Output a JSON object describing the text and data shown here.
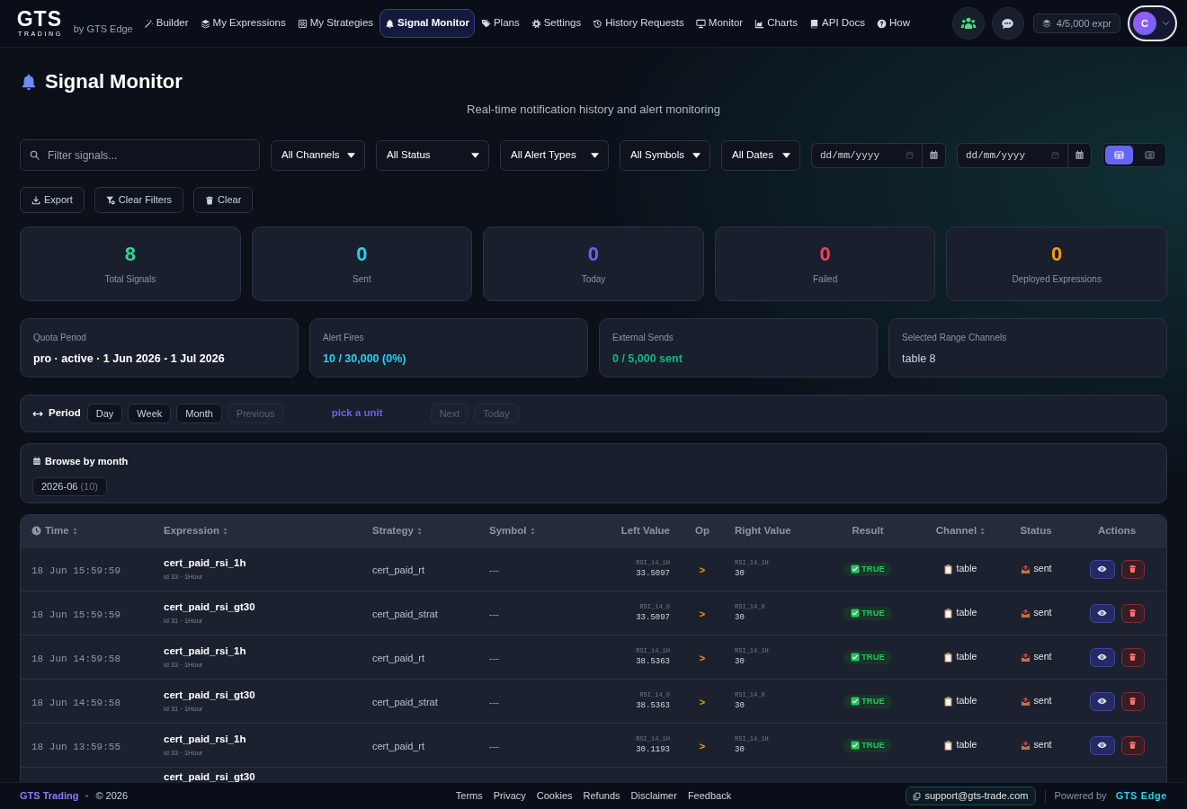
{
  "nav": {
    "logo": {
      "wordmark": "GTS",
      "tagline": "TRADING"
    },
    "byline": "by GTS Edge",
    "items": [
      {
        "label": "Builder",
        "selected": false
      },
      {
        "label": "My Expressions",
        "selected": false
      },
      {
        "label": "My Strategies",
        "selected": false
      },
      {
        "label": "Signal Monitor",
        "selected": true
      },
      {
        "label": "Plans",
        "selected": false
      },
      {
        "label": "Settings",
        "selected": false
      },
      {
        "label": "History Requests",
        "selected": false
      },
      {
        "label": "Monitor",
        "selected": false
      },
      {
        "label": "Charts",
        "selected": false
      },
      {
        "label": "API Docs",
        "selected": false
      },
      {
        "label": "How",
        "selected": false
      }
    ],
    "usage_badge": "4/5,000 expr",
    "avatar": "C"
  },
  "page": {
    "title": "Signal Monitor",
    "subtitle": "Real-time notification history and alert monitoring"
  },
  "filters": {
    "search": {
      "placeholder": "Filter signals..."
    },
    "selects": [
      "All Channels",
      "All Status",
      "All Alert Types",
      "All Symbols",
      "All Dates"
    ],
    "date_fields": [
      {
        "placeholder": "dd/mm/yyyy"
      },
      {
        "placeholder": "dd/mm/yyyy"
      }
    ],
    "view_toggle": [
      {
        "selected": true
      },
      {
        "selected": false
      }
    ]
  },
  "actions": [
    "Export",
    "Clear Filters",
    "Clear"
  ],
  "stats": [
    {
      "value": "8",
      "label": "Total Signals",
      "color": "#34d399"
    },
    {
      "value": "0",
      "label": "Sent",
      "color": "#22d3ee"
    },
    {
      "value": "0",
      "label": "Today",
      "color": "#6366f1"
    },
    {
      "value": "0",
      "label": "Failed",
      "color": "#f43f5e"
    },
    {
      "value": "0",
      "label": "Deployed Expressions",
      "color": "#f59e0b"
    }
  ],
  "info_cards": [
    {
      "label": "Quota Period",
      "value": "pro · active · 1 Jun 2026 - 1 Jul 2026",
      "kind": "highlight",
      "color": "#ffffff"
    },
    {
      "label": "Alert Fires",
      "value": "10 / 30,000 (0%)",
      "kind": "highlight",
      "color": "#22d3ee"
    },
    {
      "label": "External Sends",
      "value": "0 / 5,000 sent",
      "kind": "highlight",
      "color": "#10b981"
    },
    {
      "label": "Selected Range Channels",
      "value": "table 8",
      "kind": "plain",
      "color": "#cbd5e1"
    }
  ],
  "period": {
    "label": "Period",
    "units": [
      {
        "label": "Day",
        "selected": false
      },
      {
        "label": "Week",
        "selected": false
      },
      {
        "label": "Month",
        "selected": false
      }
    ],
    "previous": {
      "label": "Previous",
      "disabled": true
    },
    "hint": "pick a unit",
    "next": {
      "label": "Next",
      "disabled": true
    },
    "today": {
      "label": "Today",
      "disabled": true
    }
  },
  "browse": {
    "title": "Browse by month",
    "months": [
      {
        "label": "2026-06",
        "count": "(10)",
        "selected": false
      }
    ]
  },
  "table": {
    "columns": [
      {
        "label": "Time",
        "sortable": true
      },
      {
        "label": "Expression",
        "sortable": true
      },
      {
        "label": "Strategy",
        "sortable": true
      },
      {
        "label": "Symbol",
        "sortable": true
      },
      {
        "label": "Left Value",
        "sortable": false
      },
      {
        "label": "Op",
        "sortable": false
      },
      {
        "label": "Right Value",
        "sortable": false
      },
      {
        "label": "Result",
        "sortable": false
      },
      {
        "label": "Channel",
        "sortable": true
      },
      {
        "label": "Status",
        "sortable": false
      },
      {
        "label": "Actions",
        "sortable": false
      }
    ],
    "rows": [
      {
        "time": "18 Jun 15:59:59",
        "expression": "cert_paid_rsi_1h",
        "expression_meta": "id 33 · 1Hour",
        "strategy": "cert_paid_rt",
        "symbol": "---",
        "left_label": "RSI_14_1H",
        "left_value": "33.5097",
        "op": ">",
        "right_label": "RSI_14_1H",
        "right_value": "30",
        "result": {
          "label": "TRUE",
          "passed": true
        },
        "channel": "table",
        "status": "sent"
      },
      {
        "time": "18 Jun 15:59:59",
        "expression": "cert_paid_rsi_gt30",
        "expression_meta": "id 31 · 1Hour",
        "strategy": "cert_paid_strat",
        "symbol": "---",
        "left_label": "RSI_14_0",
        "left_value": "33.5097",
        "op": ">",
        "right_label": "RSI_14_0",
        "right_value": "30",
        "result": {
          "label": "TRUE",
          "passed": true
        },
        "channel": "table",
        "status": "sent"
      },
      {
        "time": "18 Jun 14:59:58",
        "expression": "cert_paid_rsi_1h",
        "expression_meta": "id 33 · 1Hour",
        "strategy": "cert_paid_rt",
        "symbol": "---",
        "left_label": "RSI_14_1H",
        "left_value": "38.5363",
        "op": ">",
        "right_label": "RSI_14_1H",
        "right_value": "30",
        "result": {
          "label": "TRUE",
          "passed": true
        },
        "channel": "table",
        "status": "sent"
      },
      {
        "time": "18 Jun 14:59:58",
        "expression": "cert_paid_rsi_gt30",
        "expression_meta": "id 31 · 1Hour",
        "strategy": "cert_paid_strat",
        "symbol": "---",
        "left_label": "RSI_14_0",
        "left_value": "38.5363",
        "op": ">",
        "right_label": "RSI_14_0",
        "right_value": "30",
        "result": {
          "label": "TRUE",
          "passed": true
        },
        "channel": "table",
        "status": "sent"
      },
      {
        "time": "18 Jun 13:59:55",
        "expression": "cert_paid_rsi_1h",
        "expression_meta": "id 33 · 1Hour",
        "strategy": "cert_paid_rt",
        "symbol": "---",
        "left_label": "RSI_14_1H",
        "left_value": "30.1193",
        "op": ">",
        "right_label": "RSI_14_1H",
        "right_value": "30",
        "result": {
          "label": "TRUE",
          "passed": true
        },
        "channel": "table",
        "status": "sent"
      },
      {
        "expression": "cert_paid_rsi_gt30"
      }
    ]
  },
  "footer": {
    "brand": "GTS Trading",
    "copyright": "© 2026",
    "links": [
      "Terms",
      "Privacy",
      "Cookies",
      "Refunds",
      "Disclaimer",
      "Feedback"
    ],
    "support_email": "support@gts-trade.com",
    "powered_by": "Powered by",
    "powered_brand": "GTS Edge"
  }
}
